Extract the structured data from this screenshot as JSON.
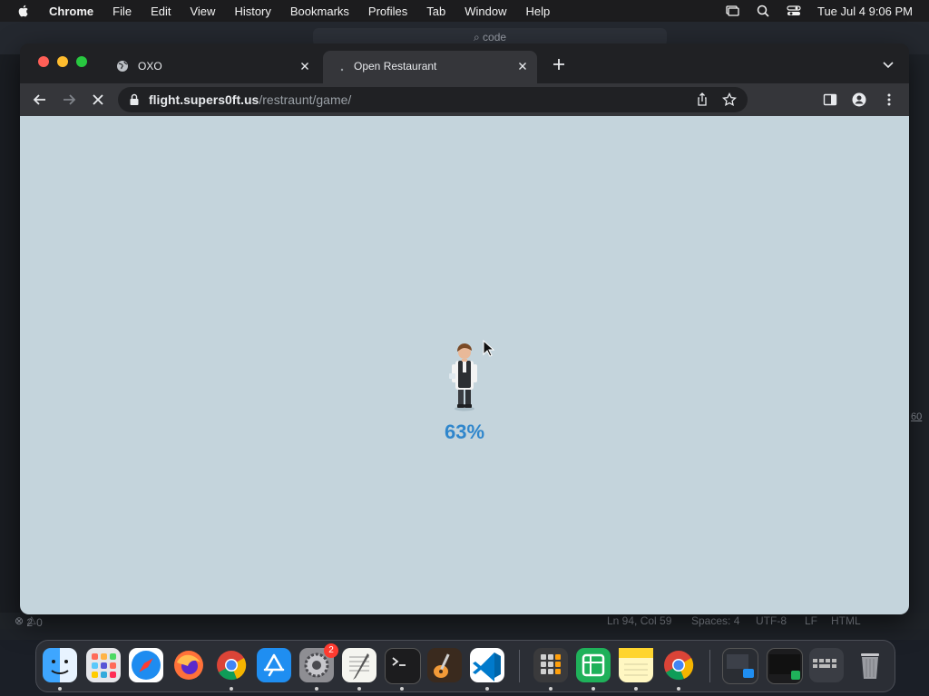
{
  "menubar": {
    "app_name": "Chrome",
    "items": [
      "File",
      "Edit",
      "View",
      "History",
      "Bookmarks",
      "Profiles",
      "Tab",
      "Window",
      "Help"
    ],
    "clock": "Tue Jul 4  9:06 PM"
  },
  "background_editor": {
    "search_placeholder": "code",
    "status": {
      "problems": "2",
      "warnings": "0",
      "position": "Ln 94, Col 59",
      "spaces": "Spaces: 4",
      "encoding": "UTF-8",
      "eol": "LF",
      "language": "HTML"
    },
    "edge_number": "60"
  },
  "browser": {
    "tabs": [
      {
        "title": "OXO",
        "favicon": "globe-icon",
        "active": false
      },
      {
        "title": "Open Restaurant",
        "favicon": "loading-dot-icon",
        "active": true
      }
    ],
    "url": {
      "host": "flight.supers0ft.us",
      "path": "/restraunt/game/"
    }
  },
  "page": {
    "loading_progress": "63%",
    "progress_value": 0.63,
    "background_color": "#c4d4dc",
    "progress_color": "#2f86cc"
  },
  "dock": {
    "apps": [
      "finder-icon",
      "launchpad-icon",
      "safari-icon",
      "firefox-icon",
      "chrome-icon",
      "app-store-icon",
      "system-settings-icon",
      "textedit-icon",
      "terminal-icon",
      "garageband-icon",
      "vscode-icon",
      "calculator-icon",
      "numbers-icon",
      "notes-icon",
      "chrome-icon",
      "downloads-stack-icon",
      "terminal-window-icon",
      "keyboard-viewer-icon",
      "trash-icon"
    ],
    "settings_badge": "2"
  }
}
